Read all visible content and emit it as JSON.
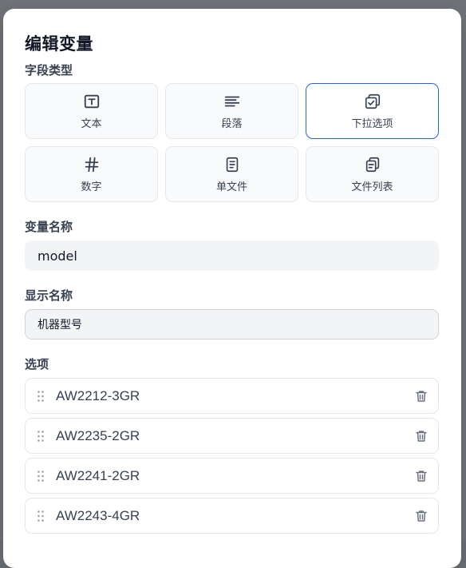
{
  "dialog": {
    "title": "编辑变量"
  },
  "field_type": {
    "label": "字段类型",
    "selected": "下拉选项",
    "options": [
      {
        "label": "文本",
        "icon": "text-icon"
      },
      {
        "label": "段落",
        "icon": "paragraph-icon"
      },
      {
        "label": "下拉选项",
        "icon": "dropdown-icon"
      },
      {
        "label": "数字",
        "icon": "hash-icon"
      },
      {
        "label": "单文件",
        "icon": "file-icon"
      },
      {
        "label": "文件列表",
        "icon": "file-list-icon"
      }
    ]
  },
  "variable_name": {
    "label": "变量名称",
    "value": "model"
  },
  "display_name": {
    "label": "显示名称",
    "value": "机器型号"
  },
  "options": {
    "label": "选项",
    "items": [
      {
        "value": "AW2212-3GR"
      },
      {
        "value": "AW2235-2GR"
      },
      {
        "value": "AW2241-2GR"
      },
      {
        "value": "AW2243-4GR"
      }
    ]
  },
  "colors": {
    "accent": "#2563eb",
    "icon": "#374151",
    "muted_icon": "#9ca3af",
    "trash_icon": "#6b7280"
  }
}
